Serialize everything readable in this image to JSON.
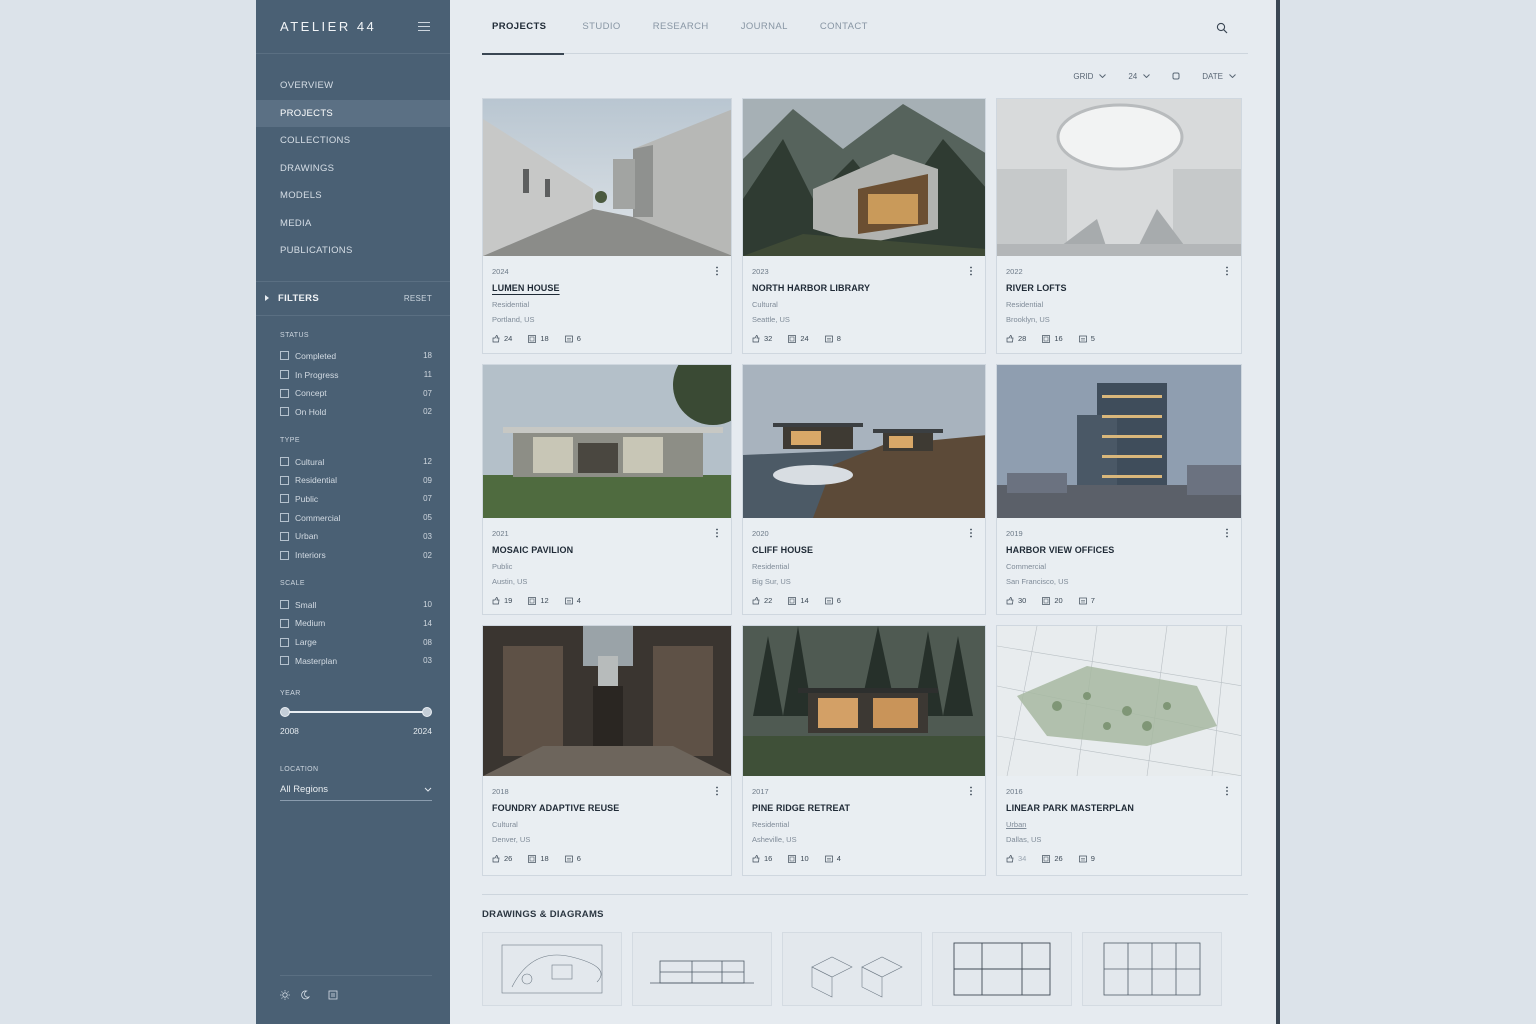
{
  "brand": "ATELIER 44",
  "nav": {
    "items": [
      {
        "label": "OVERVIEW"
      },
      {
        "label": "PROJECTS",
        "active": true
      },
      {
        "label": "COLLECTIONS"
      },
      {
        "label": "DRAWINGS"
      },
      {
        "label": "MODELS"
      },
      {
        "label": "MEDIA"
      },
      {
        "label": "PUBLICATIONS"
      }
    ]
  },
  "filters": {
    "title": "FILTERS",
    "reset": "RESET",
    "status": {
      "title": "STATUS",
      "items": [
        {
          "label": "Completed",
          "count": "18"
        },
        {
          "label": "In Progress",
          "count": "11"
        },
        {
          "label": "Concept",
          "count": "07"
        },
        {
          "label": "On Hold",
          "count": "02"
        }
      ]
    },
    "type": {
      "title": "TYPE",
      "items": [
        {
          "label": "Cultural",
          "count": "12"
        },
        {
          "label": "Residential",
          "count": "09"
        },
        {
          "label": "Public",
          "count": "07"
        },
        {
          "label": "Commercial",
          "count": "05"
        },
        {
          "label": "Urban",
          "count": "03"
        },
        {
          "label": "Interiors",
          "count": "02"
        }
      ]
    },
    "scale": {
      "title": "SCALE",
      "items": [
        {
          "label": "Small",
          "count": "10"
        },
        {
          "label": "Medium",
          "count": "14"
        },
        {
          "label": "Large",
          "count": "08"
        },
        {
          "label": "Masterplan",
          "count": "03"
        }
      ]
    },
    "year": {
      "title": "YEAR",
      "min": "2008",
      "max": "2024"
    },
    "location": {
      "title": "LOCATION",
      "value": "All Regions"
    }
  },
  "tabs": [
    {
      "label": "PROJECTS",
      "active": true
    },
    {
      "label": "STUDIO"
    },
    {
      "label": "RESEARCH"
    },
    {
      "label": "JOURNAL"
    },
    {
      "label": "CONTACT"
    }
  ],
  "toolbar": {
    "view": "GRID",
    "per_page": "24",
    "sort": "DATE"
  },
  "projects": [
    {
      "year": "2024",
      "title": "LUMEN HOUSE",
      "type": "Residential",
      "location": "Portland, US",
      "likes": "24",
      "images": "18",
      "docs": "6"
    },
    {
      "year": "2023",
      "title": "NORTH HARBOR LIBRARY",
      "type": "Cultural",
      "location": "Seattle, US",
      "likes": "32",
      "images": "24",
      "docs": "8"
    },
    {
      "year": "2022",
      "title": "RIVER LOFTS",
      "type": "Residential",
      "location": "Brooklyn, US",
      "likes": "28",
      "images": "16",
      "docs": "5"
    },
    {
      "year": "2021",
      "title": "MOSAIC PAVILION",
      "type": "Public",
      "location": "Austin, US",
      "likes": "19",
      "images": "12",
      "docs": "4"
    },
    {
      "year": "2020",
      "title": "CLIFF HOUSE",
      "type": "Residential",
      "location": "Big Sur, US",
      "likes": "22",
      "images": "14",
      "docs": "6"
    },
    {
      "year": "2019",
      "title": "HARBOR VIEW OFFICES",
      "type": "Commercial",
      "location": "San Francisco, US",
      "likes": "30",
      "images": "20",
      "docs": "7"
    },
    {
      "year": "2018",
      "title": "FOUNDRY ADAPTIVE REUSE",
      "type": "Cultural",
      "location": "Denver, US",
      "likes": "26",
      "images": "18",
      "docs": "6"
    },
    {
      "year": "2017",
      "title": "PINE RIDGE RETREAT",
      "type": "Residential",
      "location": "Asheville, US",
      "likes": "16",
      "images": "10",
      "docs": "4"
    },
    {
      "year": "2016",
      "title": "LINEAR PARK MASTERPLAN",
      "type": "Urban",
      "location": "Dallas, US",
      "likes": "34",
      "images": "26",
      "docs": "9"
    }
  ],
  "drawings_section": {
    "title": "DRAWINGS & DIAGRAMS"
  }
}
